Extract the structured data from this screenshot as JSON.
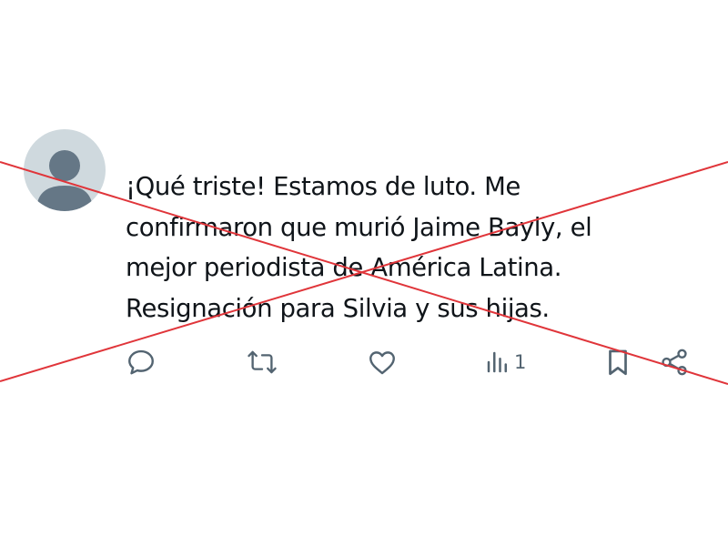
{
  "tweet": {
    "lines": [
      "¡Qué triste! Estamos de luto. Me",
      "confirmaron que murió Jaime Bayly, el",
      "mejor periodista de América Latina.",
      "Resignación para Silvia y sus hijas."
    ]
  },
  "actions": {
    "reply_icon": "speech-bubble-icon",
    "retweet_icon": "retweet-arrows-icon",
    "like_icon": "heart-icon",
    "views_icon": "bar-chart-icon",
    "views_count": "1",
    "bookmark_icon": "bookmark-icon",
    "share_icon": "share-nodes-icon"
  },
  "colors": {
    "text": "#0f1419",
    "icon": "#536471",
    "avatar_bg": "#cfd9de",
    "avatar_figure": "#657786",
    "strike": "#e0353a"
  }
}
